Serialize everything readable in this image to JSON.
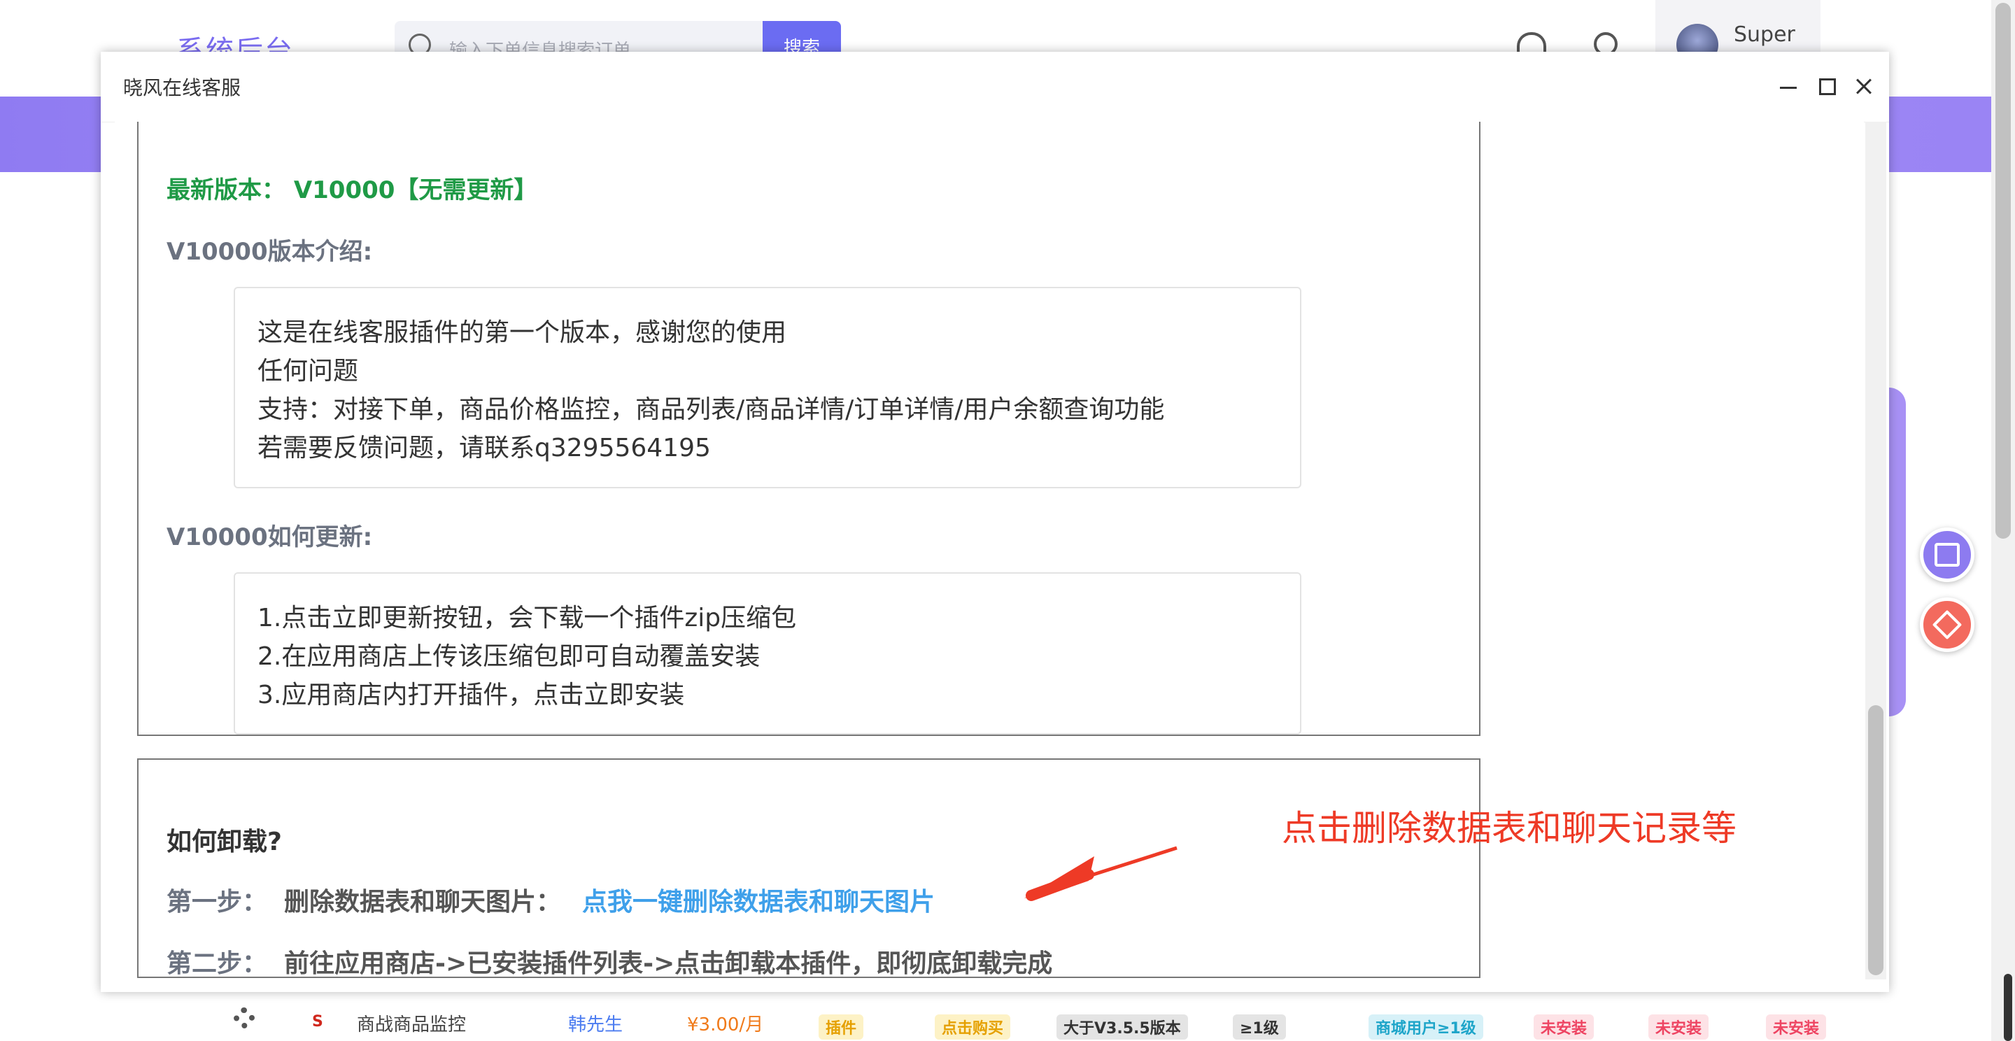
{
  "background": {
    "logo": "系统后台",
    "search": {
      "placeholder": "输入下单信息搜索订单",
      "button": "搜索"
    },
    "user_name": "Super",
    "row": {
      "name": "商战商品监控",
      "author": "韩先生",
      "price": "¥3.00/月",
      "tags": [
        "插件",
        "点击购买",
        "大于V3.5.5版本",
        "≥1级",
        "商城用户≥1级",
        "未安装",
        "未安装",
        "未安装"
      ]
    }
  },
  "modal": {
    "title": "晓风在线客服",
    "latest_version": "最新版本： V10000【无需更新】",
    "intro": {
      "heading": "V10000版本介绍:",
      "lines": [
        "这是在线客服插件的第一个版本，感谢您的使用",
        "任何问题",
        "支持：对接下单，商品价格监控，商品列表/商品详情/订单详情/用户余额查询功能",
        "若需要反馈问题，请联系q3295564195"
      ]
    },
    "update": {
      "heading": "V10000如何更新:",
      "lines": [
        "1.点击立即更新按钮，会下载一个插件zip压缩包",
        "2.在应用商店上传该压缩包即可自动覆盖安装",
        "3.应用商店内打开插件，点击立即安装"
      ]
    },
    "uninstall": {
      "heading": "如何卸载?",
      "step1_label": "第一步：",
      "step1_desc": "删除数据表和聊天图片：",
      "step1_link": "点我一键删除数据表和聊天图片",
      "step2_label": "第二步：",
      "step2_desc": "前往应用商店->已安装插件列表->点击卸载本插件，即彻底卸载完成"
    }
  },
  "annotation": "点击删除数据表和聊天记录等",
  "colors": {
    "accent": "#8f7bf2",
    "green": "#1f9a46",
    "link": "#3fa0ea",
    "annotation": "#ee3a26"
  }
}
